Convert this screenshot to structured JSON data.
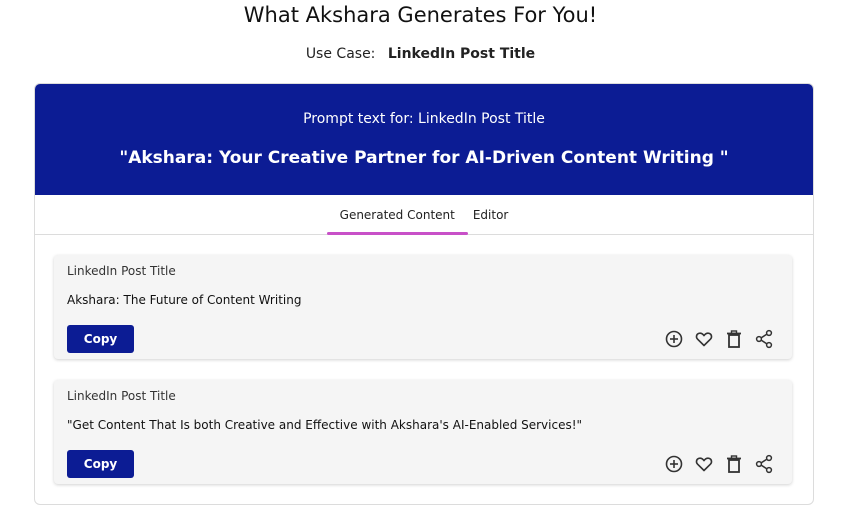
{
  "page": {
    "title": "What Akshara Generates For You!",
    "use_case_label": "Use Case:",
    "use_case_value": "LinkedIn Post Title"
  },
  "prompt": {
    "label": "Prompt text for:  LinkedIn Post Title",
    "text": "\"Akshara: Your Creative Partner for AI-Driven Content Writing \""
  },
  "tabs": [
    {
      "label": "Generated Content",
      "active": true
    },
    {
      "label": "Editor",
      "active": false
    }
  ],
  "cards": [
    {
      "type": "LinkedIn Post Title",
      "text": "Akshara: The Future of Content Writing",
      "copy_label": "Copy"
    },
    {
      "type": "LinkedIn Post Title",
      "text": "\"Get Content That Is both Creative and Effective with Akshara's AI-Enabled Services!\"",
      "copy_label": "Copy"
    }
  ],
  "icons": [
    "add-circle-icon",
    "heart-icon",
    "trash-icon",
    "share-icon"
  ],
  "colors": {
    "header_bg": "#0c1c94",
    "button_bg": "#0c1c94",
    "tab_indicator": "#c850c8",
    "card_bg": "#f5f5f5"
  }
}
